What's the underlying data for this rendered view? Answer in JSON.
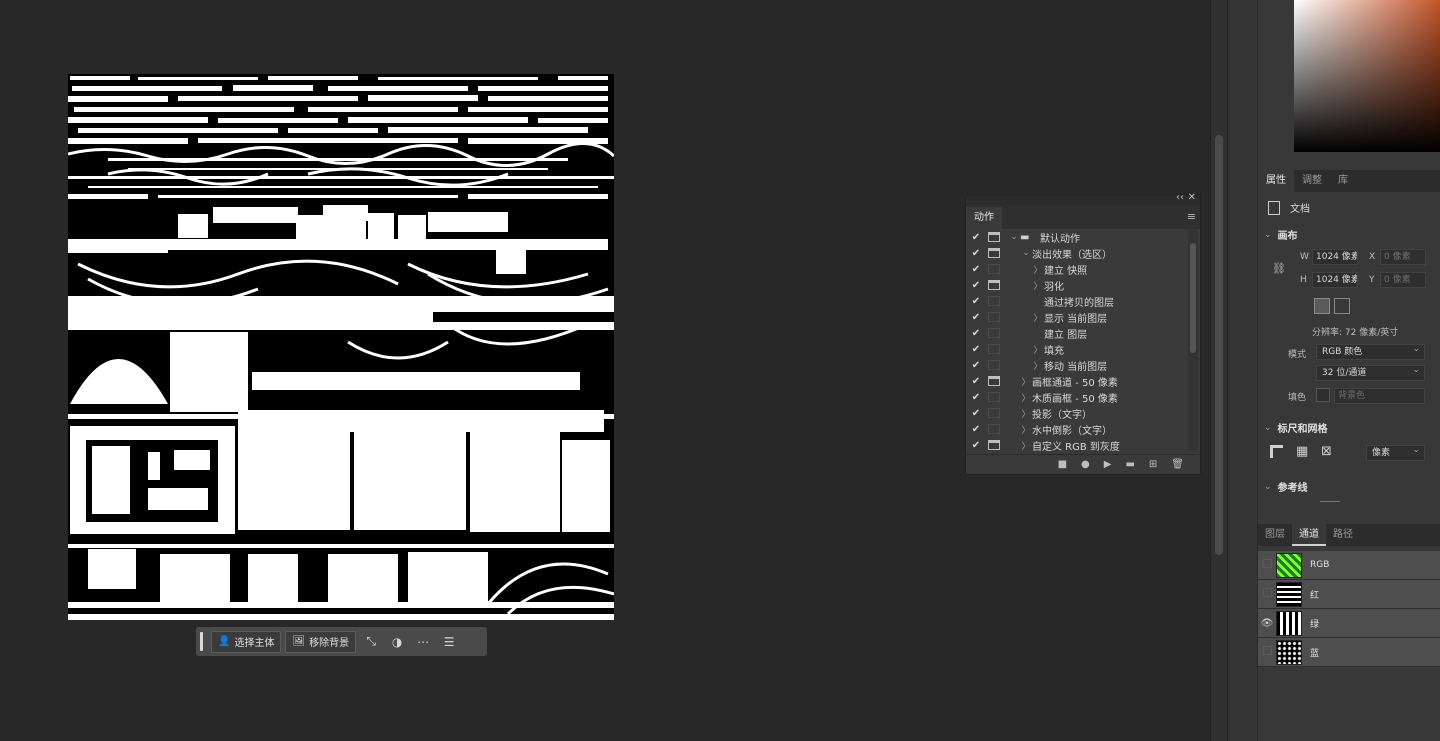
{
  "taskbar": {
    "select_subject": "选择主体",
    "remove_background": "移除背景"
  },
  "actions_panel": {
    "tab": "动作",
    "rows": [
      {
        "check": "✔",
        "dialog": true,
        "twisty": "⌄",
        "folder": true,
        "label": "默认动作"
      },
      {
        "check": "✔",
        "dialog": true,
        "twisty": "⌄",
        "folder": false,
        "label": "淡出效果（选区）"
      },
      {
        "check": "✔",
        "dialog": false,
        "twisty": "〉",
        "folder": false,
        "label": "建立 快照"
      },
      {
        "check": "✔",
        "dialog": true,
        "twisty": "〉",
        "folder": false,
        "label": "羽化"
      },
      {
        "check": "✔",
        "dialog": false,
        "twisty": "",
        "folder": false,
        "label": "通过拷贝的图层"
      },
      {
        "check": "✔",
        "dialog": false,
        "twisty": "〉",
        "folder": false,
        "label": "显示 当前图层"
      },
      {
        "check": "✔",
        "dialog": false,
        "twisty": "",
        "folder": false,
        "label": "建立 图层"
      },
      {
        "check": "✔",
        "dialog": false,
        "twisty": "〉",
        "folder": false,
        "label": "填充"
      },
      {
        "check": "✔",
        "dialog": false,
        "twisty": "〉",
        "folder": false,
        "label": "移动 当前图层"
      },
      {
        "check": "✔",
        "dialog": true,
        "twisty": "〉",
        "folder": false,
        "label": "画框通道 - 50 像素"
      },
      {
        "check": "✔",
        "dialog": false,
        "twisty": "〉",
        "folder": false,
        "label": "木质画框 - 50 像素"
      },
      {
        "check": "✔",
        "dialog": false,
        "twisty": "〉",
        "folder": false,
        "label": "投影（文字）"
      },
      {
        "check": "✔",
        "dialog": false,
        "twisty": "〉",
        "folder": false,
        "label": "水中倒影（文字）"
      },
      {
        "check": "✔",
        "dialog": true,
        "twisty": "〉",
        "folder": false,
        "label": "自定义 RGB 到灰度"
      }
    ]
  },
  "properties": {
    "tabs": [
      "属性",
      "调整",
      "库"
    ],
    "doc_label": "文档",
    "canvas_title": "画布",
    "w_label": "W",
    "w_value": "1024 像素",
    "h_label": "H",
    "h_value": "1024 像素",
    "x_label": "X",
    "x_placeholder": "0 像素",
    "y_label": "Y",
    "y_placeholder": "0 像素",
    "resolution": "分辨率: 72 像素/英寸",
    "mode_label": "模式",
    "mode_value": "RGB 颜色",
    "depth_value": "32 位/通道",
    "fill_label": "填色",
    "fill_value": "背景色",
    "rulers_title": "标尺和网格",
    "unit_value": "像素",
    "guides_title": "参考线"
  },
  "channels_panel": {
    "tabs": [
      "图层",
      "通道",
      "路径"
    ],
    "channels": [
      {
        "name": "RGB",
        "visible": false
      },
      {
        "name": "红",
        "visible": false
      },
      {
        "name": "绿",
        "visible": true
      },
      {
        "name": "蓝",
        "visible": false
      }
    ]
  },
  "colors": {
    "workspace": "#282828",
    "panel": "#383838",
    "accent_swatch": "#c4542a"
  }
}
